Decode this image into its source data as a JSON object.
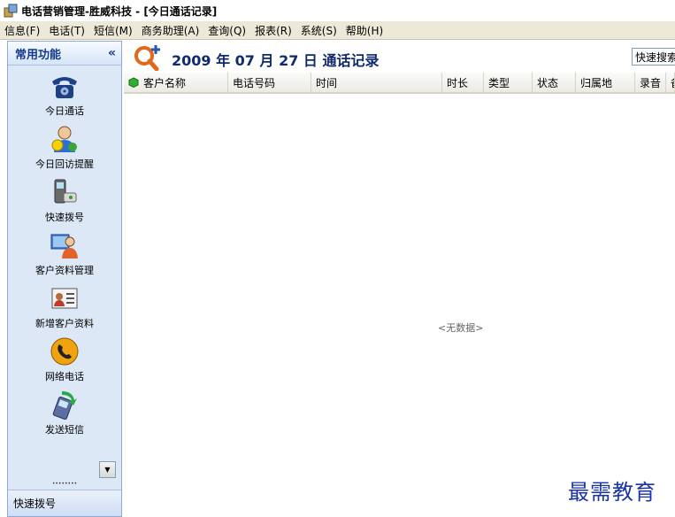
{
  "window": {
    "title": "电话营销管理-胜威科技 - [今日通话记录]"
  },
  "menu": [
    {
      "label": "信息(F)"
    },
    {
      "label": "电话(T)"
    },
    {
      "label": "短信(M)"
    },
    {
      "label": "商务助理(A)"
    },
    {
      "label": "查询(Q)"
    },
    {
      "label": "报表(R)"
    },
    {
      "label": "系统(S)"
    },
    {
      "label": "帮助(H)"
    }
  ],
  "sidebar": {
    "title": "常用功能",
    "collapse_glyph": "«",
    "items": [
      {
        "label": "今日通话",
        "icon": "telephone-icon"
      },
      {
        "label": "今日回访提醒",
        "icon": "user-reminder-icon"
      },
      {
        "label": "快速拨号",
        "icon": "mobile-phone-icon"
      },
      {
        "label": "客户资料管理",
        "icon": "customer-computer-icon"
      },
      {
        "label": "新增客户资料",
        "icon": "contact-card-icon"
      },
      {
        "label": "网络电话",
        "icon": "voip-phone-icon"
      },
      {
        "label": "发送短信",
        "icon": "send-sms-icon"
      }
    ],
    "scroll_glyph": "▼",
    "grip": "••••••••",
    "footer": "快速拨号"
  },
  "header": {
    "date_title": "2009 年 07 月 27 日 通话记录",
    "quick_search": "快速搜索"
  },
  "grid": {
    "columns": [
      "客户名称",
      "电话号码",
      "时间",
      "时长",
      "类型",
      "状态",
      "归属地",
      "录音",
      "备"
    ],
    "rows": [],
    "empty_text": "<无数据>"
  },
  "watermark": "最需教育",
  "colors": {
    "accent": "#102a6e",
    "sidebar_bg": "#dde8f7",
    "menubar_bg": "#ece9d8"
  }
}
